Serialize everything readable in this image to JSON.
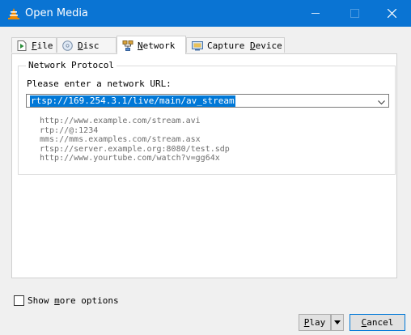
{
  "window": {
    "title": "Open Media"
  },
  "tabs": [
    {
      "pre": "",
      "key": "F",
      "post": "ile",
      "icon": "file-icon"
    },
    {
      "pre": "",
      "key": "D",
      "post": "isc",
      "icon": "disc-icon"
    },
    {
      "pre": "",
      "key": "N",
      "post": "etwork",
      "icon": "network-icon",
      "active": true
    },
    {
      "pre": "Capture ",
      "key": "D",
      "post": "evice",
      "icon": "capture-device-icon"
    }
  ],
  "network": {
    "group_title": "Network Protocol",
    "prompt": "Please enter a network URL:",
    "url_value": "rtsp://169.254.3.1/live/main/av_stream",
    "examples": [
      "http://www.example.com/stream.avi",
      "rtp://@:1234",
      "mms://mms.examples.com/stream.asx",
      "rtsp://server.example.org:8080/test.sdp",
      "http://www.yourtube.com/watch?v=gg64x"
    ]
  },
  "footer": {
    "more_pre": "Show ",
    "more_key": "m",
    "more_post": "ore options",
    "play_key": "P",
    "play_post": "lay",
    "cancel_key": "C",
    "cancel_post": "ancel"
  },
  "colors": {
    "titlebar": "#0a74d3",
    "selection": "#0078d7",
    "accent_cone": "#f08a00"
  }
}
